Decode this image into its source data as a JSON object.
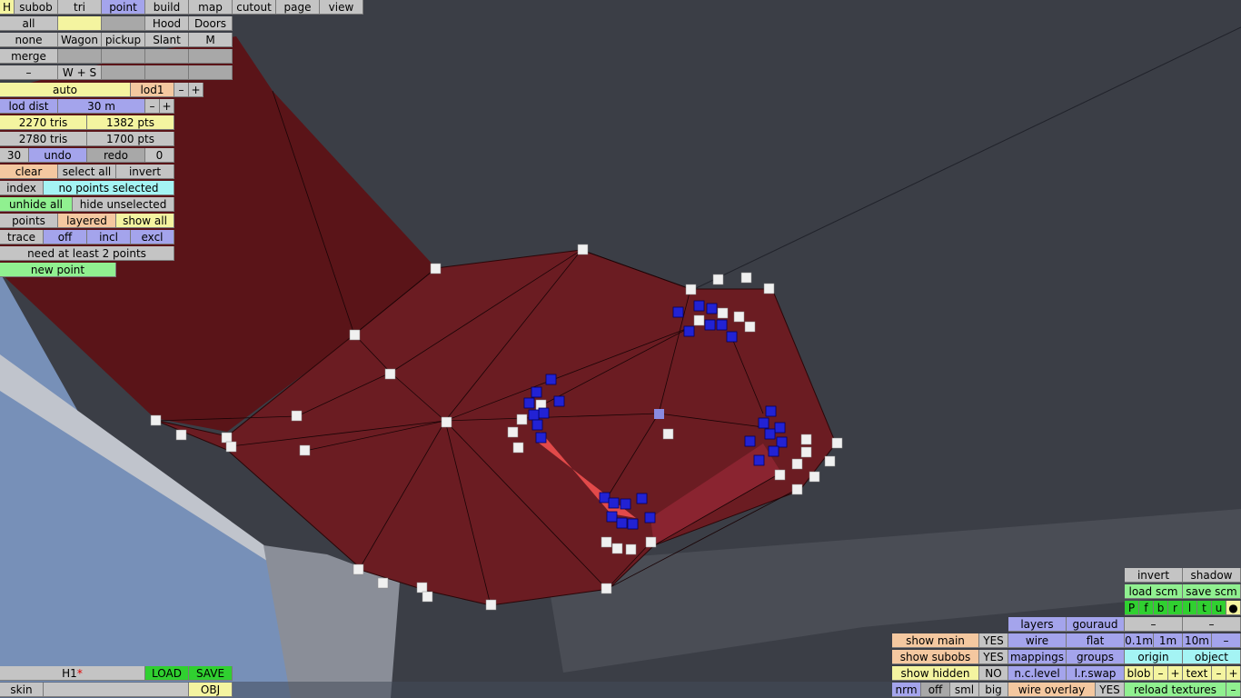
{
  "toolbar": {
    "row1": [
      "H",
      "subob",
      "tri",
      "point",
      "build",
      "map",
      "cutout",
      "page",
      "view"
    ],
    "row2": [
      "all",
      "",
      "",
      "Hood",
      "Doors"
    ],
    "row3": [
      "none",
      "Wagon",
      "pickup",
      "Slant",
      "M"
    ],
    "row4": [
      "merge",
      "",
      "",
      "",
      ""
    ],
    "row5": [
      "–",
      "W + S",
      "",
      "",
      ""
    ]
  },
  "panel": {
    "auto": "auto",
    "lod": "lod1",
    "minus": "–",
    "plus": "+",
    "lod_dist_label": "lod dist",
    "lod_dist_value": "30 m",
    "tris1": "2270 tris",
    "pts1": "1382 pts",
    "tris2": "2780 tris",
    "pts2": "1700 pts",
    "undo_count": "30",
    "undo": "undo",
    "redo": "redo",
    "redo_count": "0",
    "clear": "clear",
    "select_all": "select all",
    "invert": "invert",
    "index": "index",
    "selection_status": "no points selected",
    "unhide_all": "unhide all",
    "hide_unselected": "hide unselected",
    "points": "points",
    "layered": "layered",
    "show_all": "show all",
    "trace": "trace",
    "off": "off",
    "incl": "incl",
    "excl": "excl",
    "need": "need at least 2 points",
    "new_point": "new point"
  },
  "bottom_left": {
    "name": "H1",
    "modified_mark": "*",
    "load": "LOAD",
    "save": "SAVE",
    "skin": "skin",
    "obj": "OBJ"
  },
  "bottom_right": {
    "invert": "invert",
    "shadow": "shadow",
    "load_scm": "load scm",
    "save_scm": "save scm",
    "flags": [
      "P",
      "f",
      "b",
      "r",
      "l",
      "t",
      "u",
      "●"
    ],
    "layers": "layers",
    "gouraud": "gouraud",
    "dash": "–",
    "show_main": "show main",
    "show_main_val": "YES",
    "wire": "wire",
    "flat": "flat",
    "grid": [
      "0.1m",
      "1m",
      "10m",
      "–"
    ],
    "show_subobs": "show subobs",
    "show_subobs_val": "YES",
    "mappings": "mappings",
    "groups": "groups",
    "origin": "origin",
    "object": "object",
    "show_hidden": "show hidden",
    "show_hidden_val": "NO",
    "nc_level": "n.c.level",
    "lr_swap": "l.r.swap",
    "blob": "blob",
    "text": "text",
    "plus": "+",
    "nrm": "nrm",
    "off": "off",
    "sml": "sml",
    "big": "big",
    "wire_overlay": "wire overlay",
    "wire_overlay_val": "YES",
    "reload_textures": "reload textures"
  },
  "colors": {
    "mesh": "#6b1c22",
    "selected_point": "#2020d0",
    "point": "#f0f0f0",
    "background": "#3c3f47"
  }
}
